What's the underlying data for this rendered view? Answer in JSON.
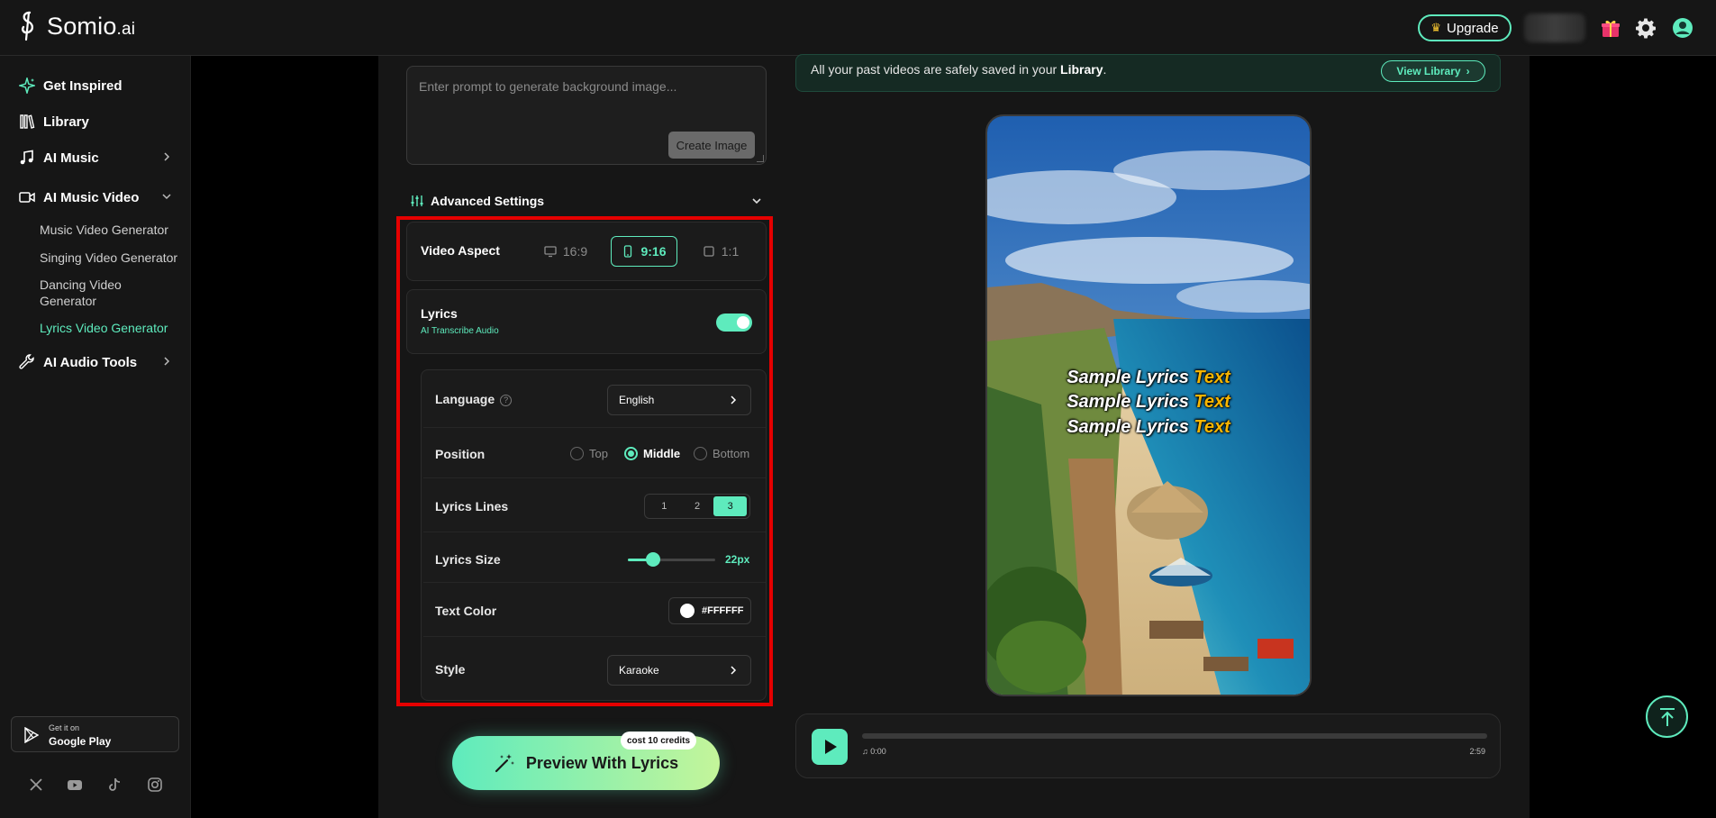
{
  "brand": {
    "name": "Somio",
    "suffix": ".ai"
  },
  "header": {
    "upgrade_label": "Upgrade"
  },
  "sidebar": {
    "items": [
      {
        "label": "Get Inspired"
      },
      {
        "label": "Library"
      },
      {
        "label": "AI Music"
      },
      {
        "label": "AI Music Video"
      },
      {
        "label": "AI Audio Tools"
      }
    ],
    "sub_items": [
      {
        "label": "Music Video Generator"
      },
      {
        "label": "Singing Video Generator"
      },
      {
        "label": "Dancing Video Generator"
      },
      {
        "label": "Lyrics Video Generator"
      }
    ],
    "google_play": {
      "line1": "Get it on",
      "line2": "Google Play"
    }
  },
  "prompt": {
    "placeholder": "Enter prompt to generate background image...",
    "create_label": "Create Image"
  },
  "advanced": {
    "title": "Advanced Settings",
    "video_aspect": {
      "label": "Video Aspect",
      "options": [
        "16:9",
        "9:16",
        "1:1"
      ],
      "selected": "9:16"
    },
    "lyrics": {
      "label": "Lyrics",
      "sublabel": "AI Transcribe Audio",
      "enabled": true
    },
    "language": {
      "label": "Language",
      "value": "English"
    },
    "position": {
      "label": "Position",
      "options": [
        "Top",
        "Middle",
        "Bottom"
      ],
      "selected": "Middle"
    },
    "lyrics_lines": {
      "label": "Lyrics Lines",
      "options": [
        "1",
        "2",
        "3"
      ],
      "selected": "3"
    },
    "lyrics_size": {
      "label": "Lyrics Size",
      "value": "22px",
      "level": 0.29
    },
    "text_color": {
      "label": "Text Color",
      "value": "#FFFFFF"
    },
    "style": {
      "label": "Style",
      "value": "Karaoke"
    }
  },
  "action": {
    "preview_label": "Preview With Lyrics",
    "cost_label": "cost 10 credits"
  },
  "notice": {
    "text_pre": "All your past videos are safely saved in your ",
    "text_bold": "Library",
    "text_post": ".",
    "button_label": "View Library"
  },
  "preview": {
    "lyric_word": "Sample Lyrics",
    "lyric_highlight": "Text"
  },
  "player": {
    "current_time": "0:00",
    "duration": "2:59",
    "progress": 0
  },
  "colors": {
    "accent": "#5eebbd",
    "highlight_border": "#e50000",
    "lyric_highlight": "#f7b500"
  }
}
